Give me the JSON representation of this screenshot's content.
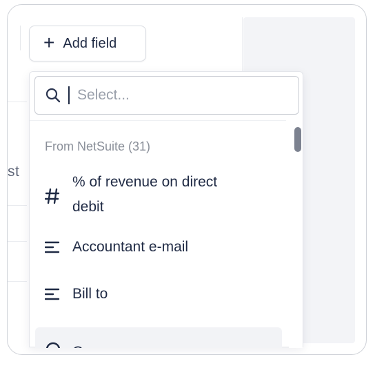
{
  "toolbar": {
    "add_field_label": "Add field"
  },
  "search": {
    "value": "",
    "placeholder": "Select..."
  },
  "list": {
    "group_label": "From NetSuite (31)",
    "items": [
      {
        "label_line1": "% of revenue on direct",
        "label_line2": "debit",
        "icon": "hash-icon"
      },
      {
        "label": "Accountant e-mail",
        "icon": "text-lines-icon"
      },
      {
        "label": "Bill to",
        "icon": "text-lines-icon"
      },
      {
        "label": "C...",
        "icon": "circle-icon"
      }
    ]
  },
  "background": {
    "left_fragment_text": "st"
  },
  "colors": {
    "text": "#1f2a44",
    "muted": "#8a8f99",
    "panel": "#f3f4f7",
    "border": "#d8dbe1"
  }
}
